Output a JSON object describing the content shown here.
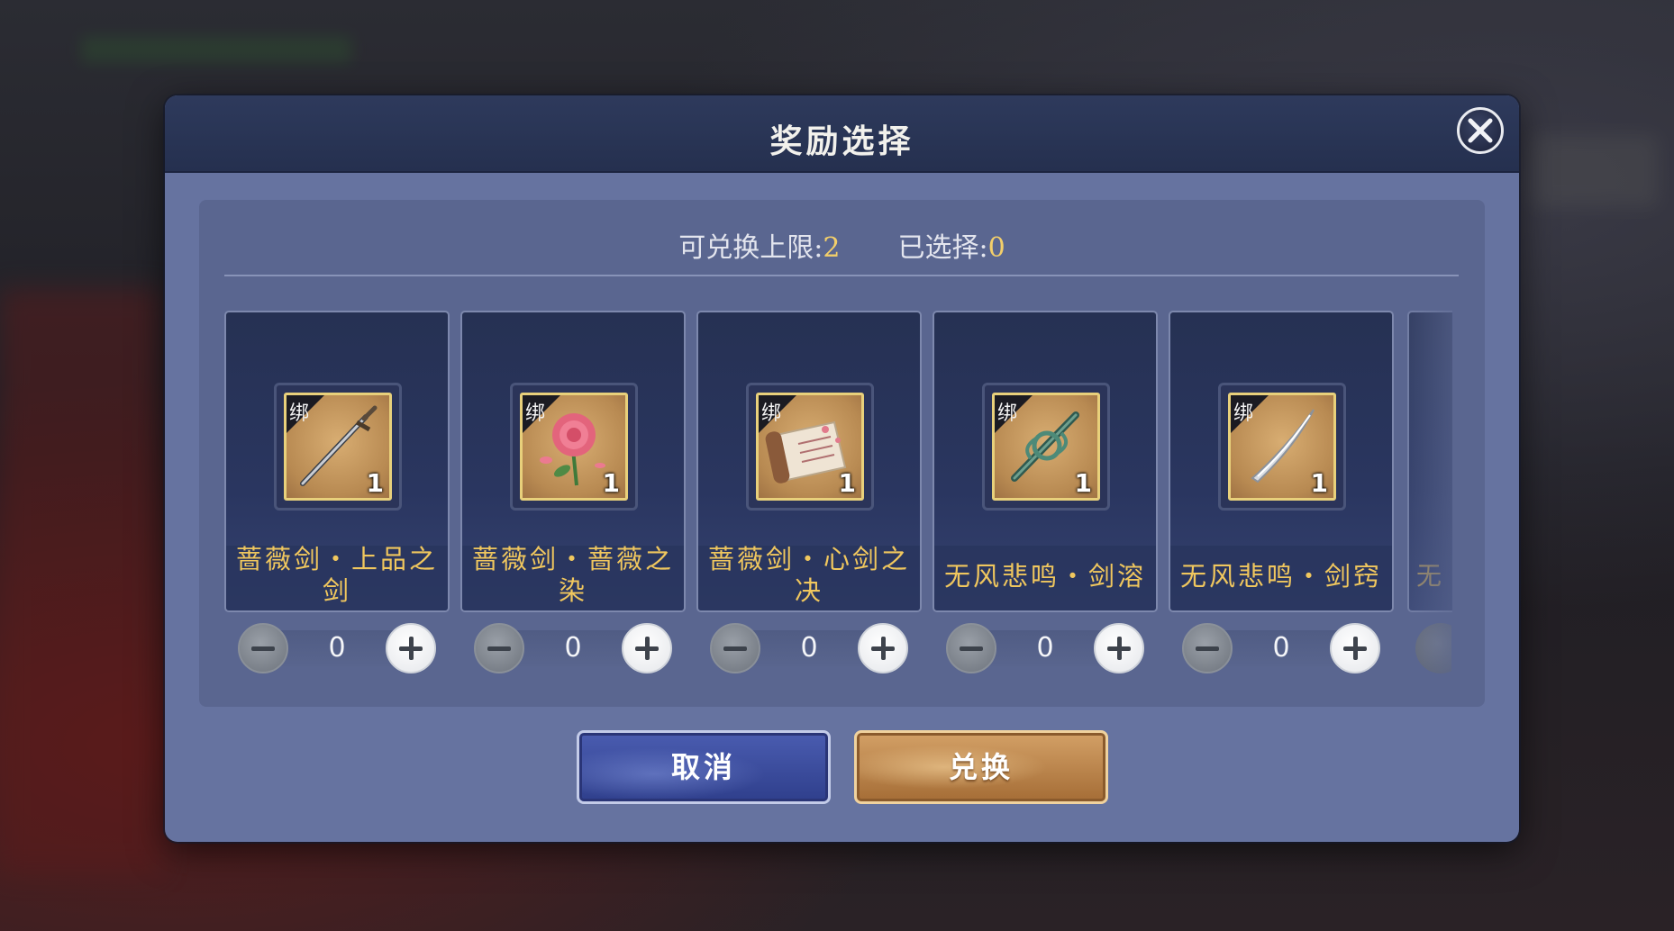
{
  "dialog": {
    "title": "奖励选择",
    "close_icon": "close-icon"
  },
  "stats": {
    "limit_label": "可兑换上限:",
    "limit_value": "2",
    "selected_label": "已选择:",
    "selected_value": "0"
  },
  "items": [
    {
      "line1": "蔷薇剑・上品之",
      "line2": "剑",
      "bind_tag": "绑",
      "count": "1",
      "quantity": "0",
      "icon": "sword-icon"
    },
    {
      "line1": "蔷薇剑・蔷薇之",
      "line2": "染",
      "bind_tag": "绑",
      "count": "1",
      "quantity": "0",
      "icon": "rose-icon"
    },
    {
      "line1": "蔷薇剑・心剑之",
      "line2": "决",
      "bind_tag": "绑",
      "count": "1",
      "quantity": "0",
      "icon": "scroll-icon"
    },
    {
      "line1": "无风悲鸣・剑溶",
      "line2": "",
      "bind_tag": "绑",
      "count": "1",
      "quantity": "0",
      "icon": "hilt-icon"
    },
    {
      "line1": "无风悲鸣・剑窍",
      "line2": "",
      "bind_tag": "绑",
      "count": "1",
      "quantity": "0",
      "icon": "blade-icon"
    }
  ],
  "partial_item": {
    "name_fragment": "无"
  },
  "buttons": {
    "cancel": "取消",
    "exchange": "兑换"
  },
  "colors": {
    "accent_gold": "#f3cf6a",
    "item_name": "#f0c75e",
    "panel": "#6673a0",
    "header": "#2e3a5c"
  }
}
